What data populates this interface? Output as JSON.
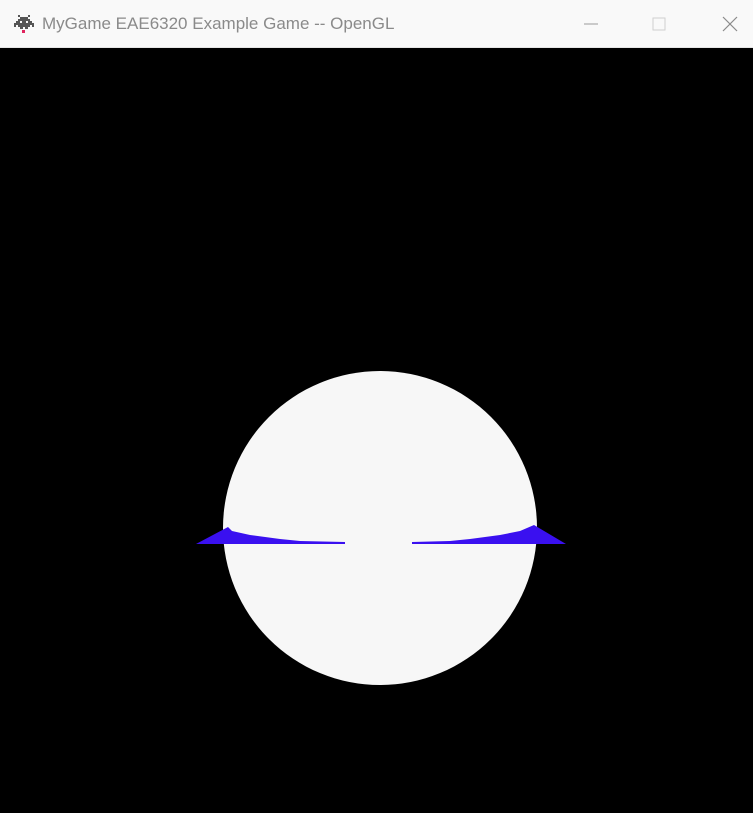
{
  "window": {
    "title": "MyGame EAE6320 Example Game -- OpenGL",
    "icon": "space-invader-icon",
    "controls": {
      "minimize_icon": "minimize-icon",
      "maximize_icon": "maximize-icon",
      "close_icon": "close-icon"
    }
  },
  "scene": {
    "background_color": "#000000",
    "sphere_color": "#f7f7f7",
    "wing_color": "#3a10f0"
  }
}
